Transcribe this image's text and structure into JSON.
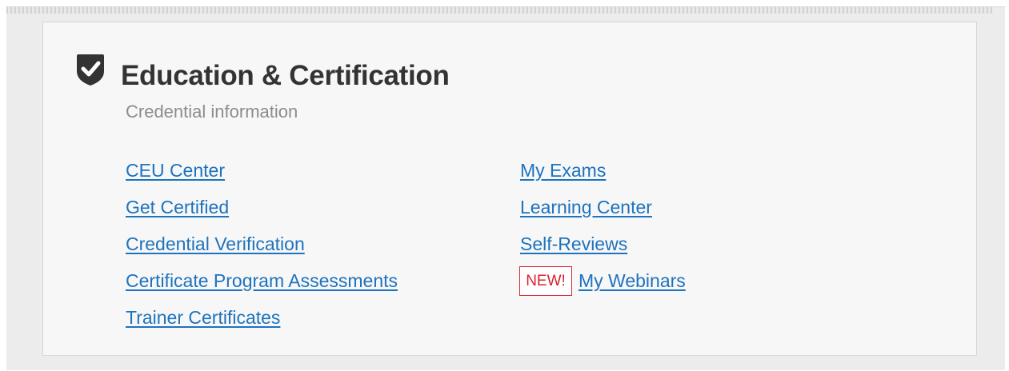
{
  "section": {
    "title": "Education & Certification",
    "subtitle": "Credential information",
    "icon": "shield-check-icon"
  },
  "links": {
    "left": [
      "CEU Center",
      "Get Certified",
      "Credential Verification",
      "Certificate Program Assessments",
      "Trainer Certificates"
    ],
    "right": [
      "My Exams",
      "Learning Center",
      "Self-Reviews",
      "My Webinars"
    ]
  },
  "badge": {
    "label": "NEW!"
  },
  "colors": {
    "link": "#1e73be",
    "title": "#333333",
    "subtitle": "#8c8c8c",
    "badge": "#d9232e",
    "card_bg": "#f7f7f7"
  }
}
